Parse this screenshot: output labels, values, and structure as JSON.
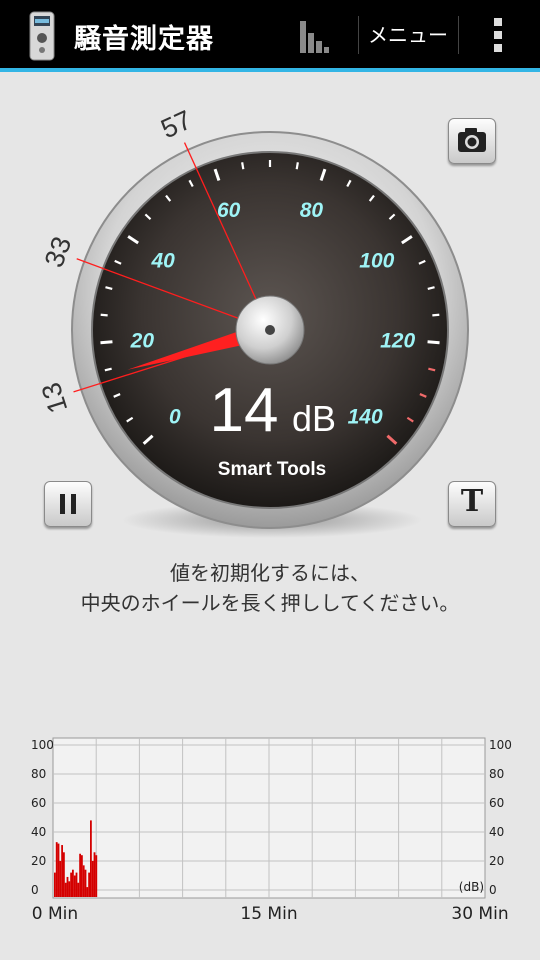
{
  "appbar": {
    "title": "騒音測定器",
    "menu_label": "メニュー",
    "icons": {
      "app": "sound-meter-app-icon",
      "stats": "bar-chart-icon",
      "overflow": "overflow-menu-icon"
    }
  },
  "meter": {
    "value": "14",
    "unit": "dB",
    "value_db": 14,
    "brand": "Smart Tools",
    "scale_labels": [
      "0",
      "20",
      "40",
      "60",
      "80",
      "100",
      "120",
      "140"
    ],
    "min_label": "13",
    "avg_label": "33",
    "max_label": "57",
    "min_db": 13,
    "avg_db": 33,
    "max_db": 57,
    "warning_color": "#f06a6a",
    "needle_color": "#ff2020",
    "scale_color": "#9ff4f6"
  },
  "buttons": {
    "text_button_label": "T",
    "icons": {
      "camera": "camera-icon",
      "pause": "pause-icon"
    }
  },
  "instructions": {
    "line1": "値を初期化するには、",
    "line2": "中央のホイールを長く押ししてください。"
  },
  "chart_data": {
    "type": "bar",
    "y_ticks_left": [
      "100",
      "80",
      "60",
      "40",
      "20",
      "0"
    ],
    "y_ticks_right": [
      "100",
      "80",
      "60",
      "40",
      "20",
      "0"
    ],
    "unit_label": "(dB)",
    "x_labels": [
      "0 Min",
      "15 Min",
      "30 Min"
    ],
    "ylim": [
      0,
      100
    ],
    "xlim": [
      0,
      30
    ],
    "grid": true,
    "color": "#d40000",
    "values": [
      12,
      33,
      32,
      20,
      31,
      26,
      5,
      9,
      6,
      12,
      14,
      10,
      12,
      5,
      25,
      24,
      17,
      14,
      2,
      12,
      48,
      20,
      26,
      24
    ]
  }
}
